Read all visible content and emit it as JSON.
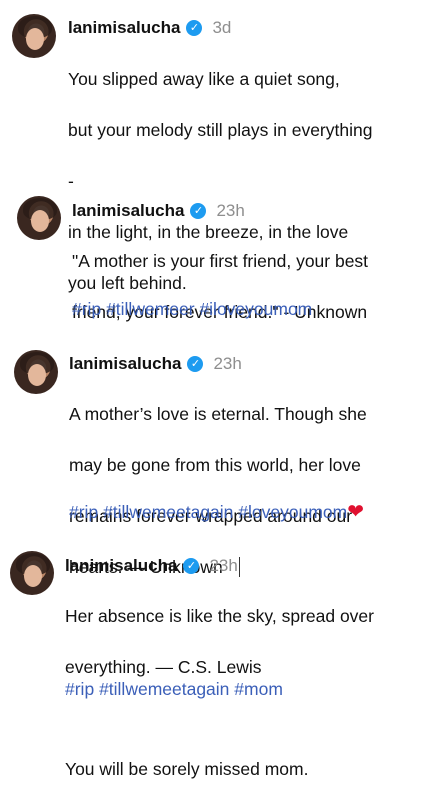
{
  "comments": [
    {
      "username": "lanimisalucha",
      "time": "3d",
      "lines": [
        "You slipped away like a quiet song,",
        "but your melody still plays in everything",
        "-",
        "in the light, in the breeze, in the love",
        "you left behind."
      ]
    },
    {
      "username": "lanimisalucha",
      "time": "23h",
      "lines": [
        "\"A mother is your first friend, your best",
        "friend, your forever friend.\" - Unknown"
      ],
      "tags": [
        "#rip",
        "#tillwemeer",
        "#iloveyoumom"
      ]
    },
    {
      "username": "lanimisalucha",
      "time": "23h",
      "lines": [
        "A mother’s love is eternal. Though she",
        "may be gone from this world, her love",
        "remains forever wrapped around our",
        "hearts. — Unknown"
      ],
      "tags": [
        "#rip",
        "#tillwemeetagain",
        "#loveyoumom"
      ],
      "emoji": "❤"
    },
    {
      "username": "lanimisalucha",
      "time": "23h",
      "lines": [
        "Her absence is like the sky, spread over",
        "everything. — C.S. Lewis",
        "",
        "You will be sorely missed mom."
      ],
      "tags": [
        "#rip",
        "#tillwemeetagain",
        "#mom"
      ]
    }
  ],
  "colors": {
    "hashtag": "#3b5fb8",
    "timestamp": "#8e8e8e",
    "verified": "#1d9bf0",
    "heart": "#e0102f"
  },
  "icons": {
    "verified": "verified-badge-icon",
    "heart": "red-heart-icon"
  }
}
